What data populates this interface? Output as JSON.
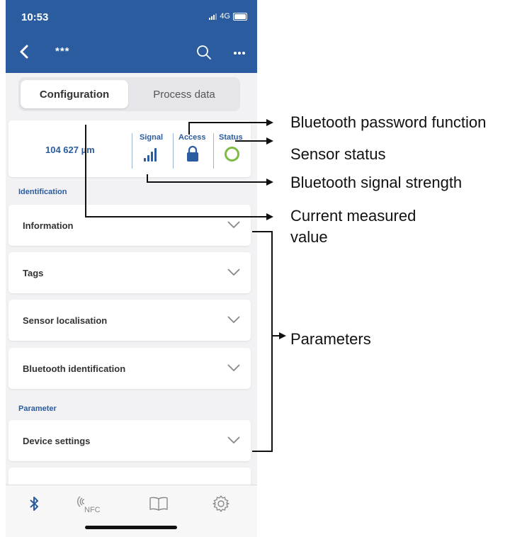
{
  "status_bar": {
    "time": "10:53",
    "network": "4G"
  },
  "nav": {
    "title": "***",
    "back_icon": "chevron-left-icon",
    "search_icon": "search-icon",
    "more_icon": "more-icon"
  },
  "segmented": {
    "tabs": [
      "Configuration",
      "Process data"
    ],
    "selected": "Configuration"
  },
  "measurement": {
    "value": "104 627 µm",
    "signal_label": "Signal",
    "access_label": "Access",
    "status_label": "Status",
    "status_color": "#7fba42"
  },
  "sections": {
    "identification": "Identification",
    "parameter": "Parameter"
  },
  "rows": {
    "information": "Information",
    "tags": "Tags",
    "sensor_localisation": "Sensor localisation",
    "bluetooth_identification": "Bluetooth identification",
    "device_settings": "Device settings"
  },
  "tabbar": {
    "items": [
      "bluetooth-icon",
      "nfc-icon",
      "book-icon",
      "gear-icon"
    ],
    "nfc_label": "NFC"
  },
  "annotations": {
    "password": "Bluetooth password function",
    "sensor_status": "Sensor status",
    "signal_strength": "Bluetooth signal strength",
    "measured_line1": "Current measured",
    "measured_line2": "value",
    "parameters": "Parameters"
  },
  "colors": {
    "brand": "#2a5c9f",
    "status_ok": "#7fba42"
  }
}
